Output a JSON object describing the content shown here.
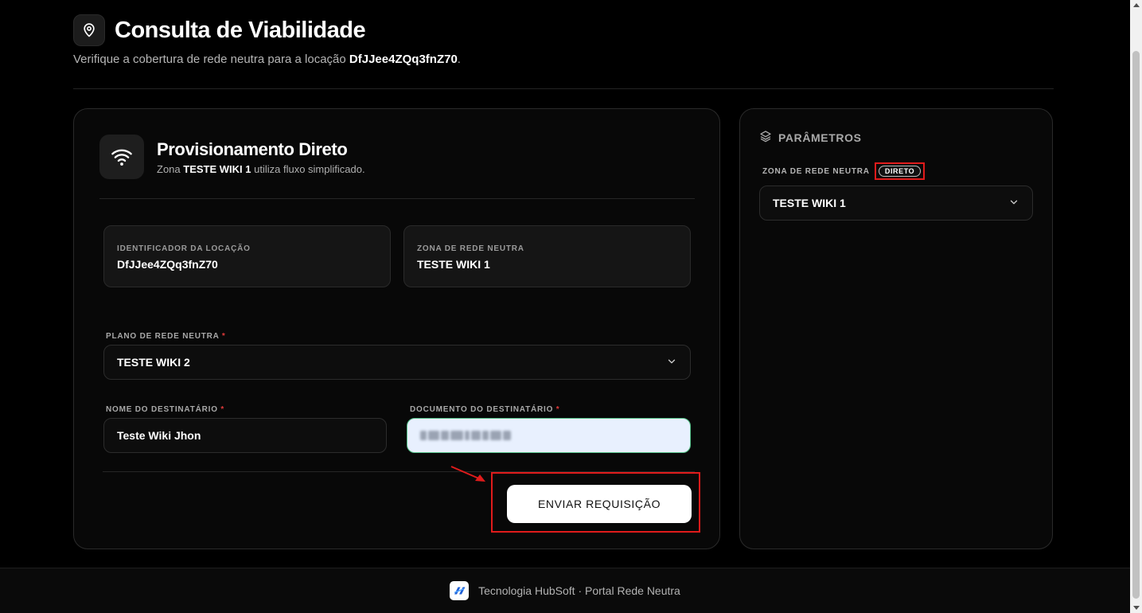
{
  "header": {
    "title": "Consulta de Viabilidade",
    "subtitle_prefix": "Verifique a cobertura de rede neutra para a locação",
    "location_id": "DfJJee4ZQq3fnZ70",
    "subtitle_suffix": "."
  },
  "card": {
    "title": "Provisionamento Direto",
    "sub_prefix": "Zona",
    "zone_name": "TESTE WIKI 1",
    "sub_suffix": "utiliza fluxo simplificado.",
    "info": {
      "location_label": "IDENTIFICADOR DA LOCAÇÃO",
      "location_value": "DfJJee4ZQq3fnZ70",
      "zone_label": "ZONA DE REDE NEUTRA",
      "zone_value": "TESTE WIKI 1"
    },
    "plan": {
      "label": "PLANO DE REDE NEUTRA",
      "required": "*",
      "value": "TESTE WIKI 2"
    },
    "recipient_name": {
      "label": "NOME DO DESTINATÁRIO",
      "required": "*",
      "value": "Teste Wiki Jhon"
    },
    "recipient_doc": {
      "label": "DOCUMENTO DO DESTINATÁRIO",
      "required": "*"
    },
    "submit_label": "ENVIAR REQUISIÇÃO"
  },
  "side": {
    "title": "PARÂMETROS",
    "zone_label": "ZONA DE REDE NEUTRA",
    "badge": "DIRETO",
    "zone_value": "TESTE WIKI 1"
  },
  "footer": {
    "text": "Tecnologia HubSoft · Portal Rede Neutra"
  },
  "colors": {
    "background": "#000000",
    "card": "#080808",
    "highlight": "#e01b1b",
    "required": "#e03a3a",
    "doc_field_bg": "#e8f0fe",
    "doc_field_border": "#56c28a"
  },
  "icons": [
    "map-pin-icon",
    "wifi-icon",
    "layers-icon",
    "chevron-down-icon",
    "hubsoft-logo"
  ]
}
